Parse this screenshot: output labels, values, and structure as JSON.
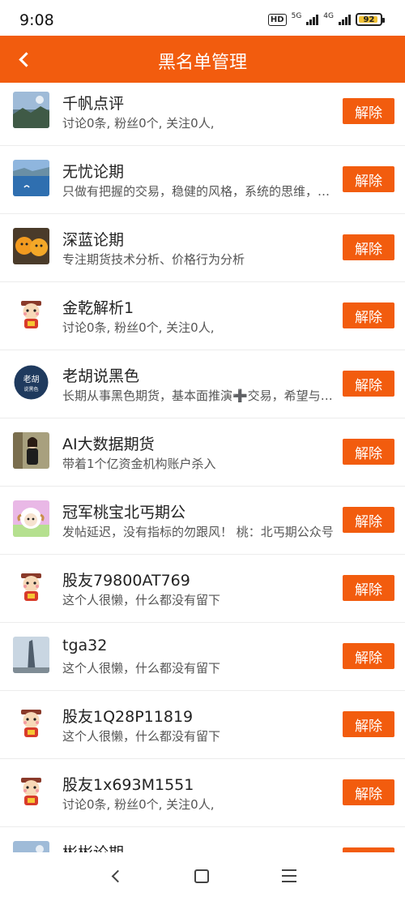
{
  "status": {
    "time": "9:08",
    "hd": "HD",
    "net1": "5G",
    "net2": "4G",
    "battery": "92",
    "battery_level": 0.92
  },
  "header": {
    "title": "黑名单管理"
  },
  "colors": {
    "accent": "#f25c0e",
    "divider": "#ececec"
  },
  "list": {
    "items": [
      {
        "name": "千帆点评",
        "desc": "讨论0条, 粉丝0个, 关注0人,",
        "button": "解除",
        "avatar": "landscape-photo"
      },
      {
        "name": "无忧论期",
        "desc": "只做有把握的交易，稳健的风格，系统的思维，长期的坚持",
        "button": "解除",
        "avatar": "sea-photo"
      },
      {
        "name": "深蓝论期",
        "desc": "专注期货技术分析、价格行为分析",
        "button": "解除",
        "avatar": "oranges-photo"
      },
      {
        "name": "金乾解析1",
        "desc": "讨论0条, 粉丝0个, 关注0人,",
        "button": "解除",
        "avatar": "mascot-icon"
      },
      {
        "name": "老胡说黑色",
        "desc": "长期从事黑色期货，基本面推演➕交易，希望与大家共同进步",
        "button": "解除",
        "avatar": "laohu-logo",
        "avatar_text_1": "老胡",
        "avatar_text_2": "说黑色"
      },
      {
        "name": "AI大数据期货",
        "desc": " 带着1个亿资金机构账户杀入",
        "button": "解除",
        "avatar": "person-photo"
      },
      {
        "name": "冠军桃宝北丐期公",
        "desc": "发帖延迟，没有指标的勿跟风！ 桃：北丐期公众号",
        "button": "解除",
        "avatar": "sheep-cartoon"
      },
      {
        "name": "股友79800AT769",
        "desc": "这个人很懒，什么都没有留下",
        "button": "解除",
        "avatar": "mascot-icon"
      },
      {
        "name": "tga32",
        "desc": "这个人很懒，什么都没有留下",
        "button": "解除",
        "avatar": "tower-photo"
      },
      {
        "name": "股友1Q28P11819",
        "desc": "这个人很懒，什么都没有留下",
        "button": "解除",
        "avatar": "mascot-icon"
      },
      {
        "name": "股友1x693M1551",
        "desc": "讨论0条, 粉丝0个, 关注0人,",
        "button": "解除",
        "avatar": "mascot-icon"
      },
      {
        "name": "彬彬论期",
        "desc": "",
        "button": "解除",
        "avatar": "landscape-photo"
      }
    ]
  },
  "navbar": {
    "back": "back-icon",
    "home": "home-icon",
    "menu": "menu-icon"
  }
}
